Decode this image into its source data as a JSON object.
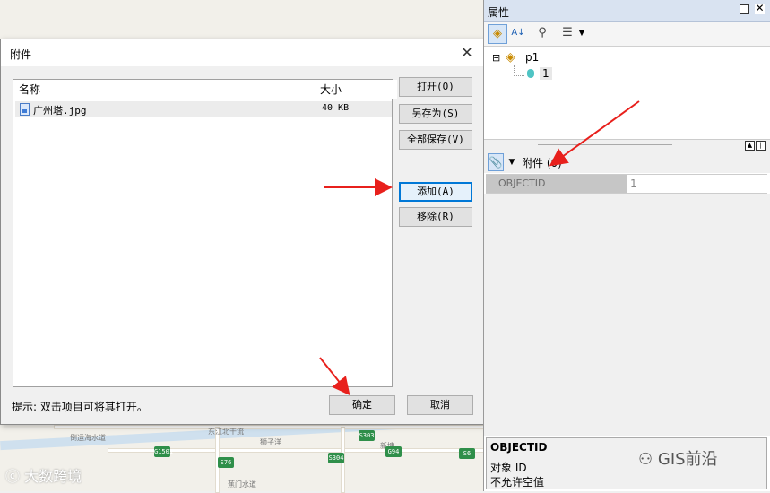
{
  "dialog": {
    "title": "附件",
    "close_glyph": "✕",
    "list": {
      "columns": [
        "名称",
        "大小"
      ],
      "rows": [
        {
          "name": "广州塔.jpg",
          "size": "40 KB",
          "icon": "image-file-icon"
        }
      ]
    },
    "buttons": {
      "open": "打开(O)",
      "save_as": "另存为(S)",
      "save_all": "全部保存(V)",
      "add": "添加(A)",
      "remove": "移除(R)",
      "ok": "确定",
      "cancel": "取消"
    },
    "hint": "提示: 双击项目可将其打开。"
  },
  "properties": {
    "title": "属性",
    "toolbar": {
      "icons": [
        "layer-diamond-icon",
        "sort-az-icon",
        "identify-icon",
        "list-options-icon",
        "dropdown-arrow-icon"
      ],
      "sort_label": "A↓"
    },
    "tree": {
      "expand_glyph": "⊟",
      "layer_name": "p1",
      "feature_value": "1"
    },
    "attachment_bar": {
      "label": "附件 (0)",
      "icon": "paperclip-icon"
    },
    "grid": {
      "field": "OBJECTID",
      "value": "1"
    },
    "description": {
      "title": "OBJECTID",
      "line1": "对象 ID",
      "line2": "不允许空值"
    }
  },
  "watermark": {
    "right": "GIS前沿",
    "left": "大数跨境"
  },
  "map_labels": {
    "l1": "新塘",
    "l2": "狮子洋",
    "l3": "东江北干流",
    "l4": "倒运海水道",
    "l5": "蕉门水道",
    "shields": [
      "G1501",
      "S303",
      "S304",
      "G94",
      "S76",
      "S6"
    ]
  },
  "colors": {
    "accent": "#0078d7",
    "arrow": "#e8201c",
    "header": "#d9e3f1",
    "shield": "#2f8f4a"
  }
}
